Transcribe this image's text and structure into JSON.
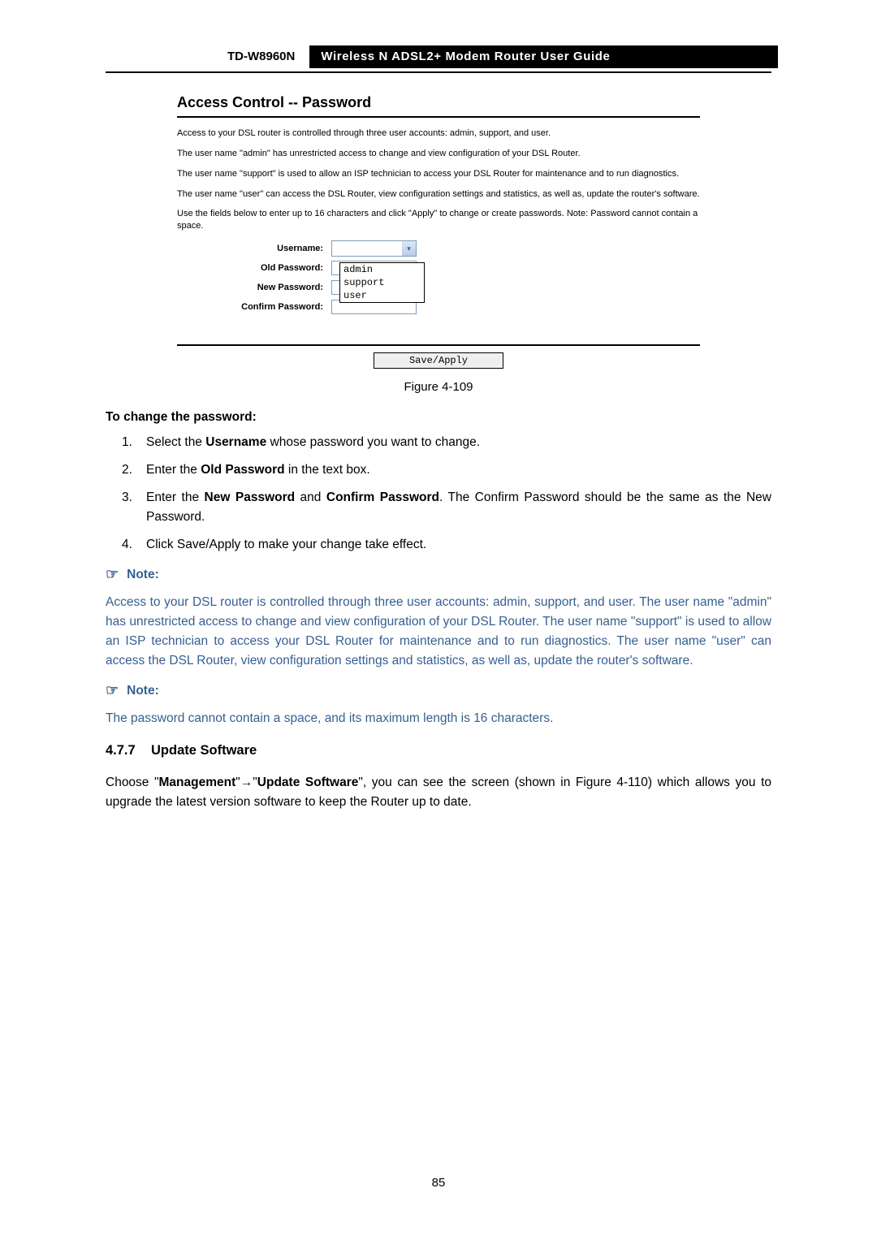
{
  "header": {
    "model": "TD-W8960N",
    "title": "Wireless N ADSL2+ Modem Router User Guide"
  },
  "figure": {
    "title": "Access Control -- Password",
    "p1": "Access to your DSL router is controlled through three user accounts: admin, support, and user.",
    "p2": "The user name \"admin\" has unrestricted access to change and view configuration of your DSL Router.",
    "p3": "The user name \"support\" is used to allow an ISP technician to access your DSL Router for maintenance and to run diagnostics.",
    "p4": "The user name \"user\" can access the DSL Router, view configuration settings and statistics, as well as, update the router's software.",
    "p5": "Use the fields below to enter up to 16 characters and click \"Apply\" to change or create passwords. Note: Password cannot contain a space.",
    "labels": {
      "username": "Username:",
      "old_pw": "Old Password:",
      "new_pw": "New Password:",
      "confirm_pw": "Confirm Password:"
    },
    "dropdown": {
      "opt1": "admin",
      "opt2": "support",
      "opt3": "user"
    },
    "save_btn": "Save/Apply",
    "caption": "Figure 4-109"
  },
  "body": {
    "heading1": "To change the password:",
    "li1a": "Select the ",
    "li1b": "Username",
    "li1c": " whose password you want to change.",
    "li2a": "Enter the ",
    "li2b": "Old Password",
    "li2c": " in the text box.",
    "li3a": "Enter the ",
    "li3b": "New Password",
    "li3c": " and ",
    "li3d": "Confirm Password",
    "li3e": ". The Confirm Password should be the same as the New Password.",
    "li4": "Click Save/Apply to make your change take effect.",
    "note_label": "Note:",
    "note1": "Access to your DSL router is controlled through three user accounts: admin, support, and user. The user name \"admin\" has unrestricted access to change and view configuration of your DSL Router. The user name \"support\" is used to allow an ISP technician to access your DSL Router for maintenance and to run diagnostics. The user name \"user\" can access the DSL Router, view configuration settings and statistics, as well as, update the router's software.",
    "note2": "The password cannot contain a space, and its maximum length is 16 characters.",
    "sect_num": "4.7.7",
    "sect_title": "Update Software",
    "p_a": "Choose \"",
    "p_b": "Management",
    "p_c": "\"",
    "p_arrow": "→",
    "p_d": "\"",
    "p_e": "Update Software",
    "p_f": "\", you can see the screen (shown in Figure 4-110) which allows you to upgrade the latest version software to keep the Router up to date."
  },
  "page_number": "85"
}
